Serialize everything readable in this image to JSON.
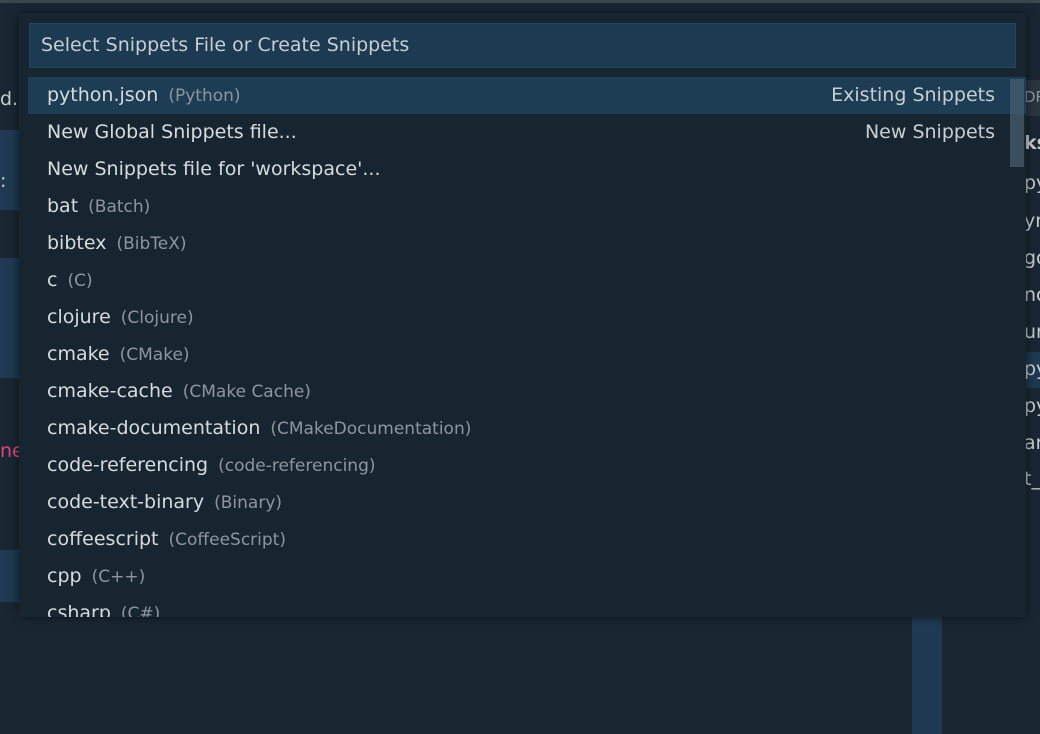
{
  "background": {
    "left_fragment_top": "d.",
    "left_fragment_mid": ":",
    "left_fragment_pink": "ne",
    "right_fragments": [
      "DR",
      "ks",
      "py",
      "yn",
      "go",
      "nc",
      "un",
      "py",
      "py",
      "an",
      "t_"
    ]
  },
  "quickpick": {
    "placeholder": "Select Snippets File or Create Snippets",
    "items": [
      {
        "label": "python.json",
        "description": "(Python)",
        "detail": "Existing Snippets"
      },
      {
        "label": "New Global Snippets file...",
        "description": "",
        "detail": "New Snippets"
      },
      {
        "label": "New Snippets file for 'workspace'...",
        "description": "",
        "detail": ""
      },
      {
        "label": "bat",
        "description": "(Batch)",
        "detail": ""
      },
      {
        "label": "bibtex",
        "description": "(BibTeX)",
        "detail": ""
      },
      {
        "label": "c",
        "description": "(C)",
        "detail": ""
      },
      {
        "label": "clojure",
        "description": "(Clojure)",
        "detail": ""
      },
      {
        "label": "cmake",
        "description": "(CMake)",
        "detail": ""
      },
      {
        "label": "cmake-cache",
        "description": "(CMake Cache)",
        "detail": ""
      },
      {
        "label": "cmake-documentation",
        "description": "(CMakeDocumentation)",
        "detail": ""
      },
      {
        "label": "code-referencing",
        "description": "(code-referencing)",
        "detail": ""
      },
      {
        "label": "code-text-binary",
        "description": "(Binary)",
        "detail": ""
      },
      {
        "label": "coffeescript",
        "description": "(CoffeeScript)",
        "detail": ""
      },
      {
        "label": "cpp",
        "description": "(C++)",
        "detail": ""
      },
      {
        "label": "csharp",
        "description": "(C#)",
        "detail": ""
      }
    ]
  },
  "colors": {
    "background": "#1a2733",
    "quickpick_bg": "#172531",
    "input_bg": "#1c3b52",
    "selected_bg": "#1d3d55",
    "accent_pink": "#e0457b"
  }
}
